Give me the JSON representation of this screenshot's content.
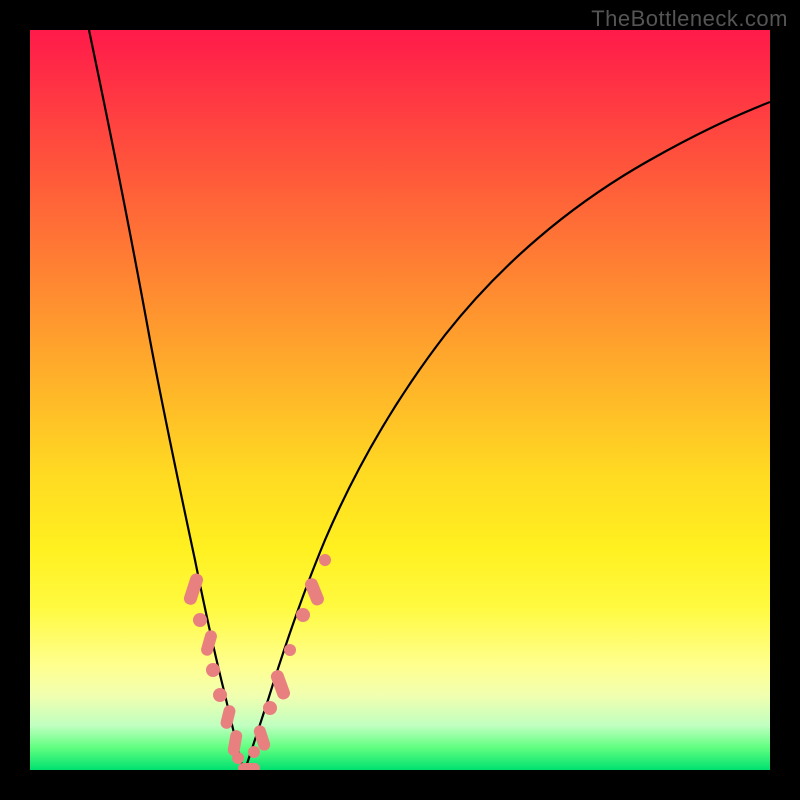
{
  "watermark": "TheBottleneck.com",
  "chart_data": {
    "type": "line",
    "title": "",
    "xlabel": "",
    "ylabel": "",
    "xlim": [
      0,
      100
    ],
    "ylim": [
      0,
      100
    ],
    "grid": false,
    "legend": false,
    "annotations": [],
    "background": "red-yellow-green vertical gradient",
    "series": [
      {
        "name": "left-curve",
        "x": [
          8,
          10,
          12,
          14,
          16,
          18,
          20,
          22,
          24,
          25,
          26,
          27,
          28
        ],
        "y": [
          100,
          85,
          70,
          57,
          45,
          35,
          26,
          18,
          10,
          6,
          3,
          1,
          0
        ]
      },
      {
        "name": "right-curve",
        "x": [
          28,
          30,
          32,
          35,
          38,
          42,
          48,
          55,
          65,
          78,
          92,
          100
        ],
        "y": [
          0,
          4,
          10,
          19,
          28,
          38,
          50,
          60,
          70,
          79,
          85,
          88
        ]
      }
    ],
    "markers": [
      {
        "series": "left",
        "x": 21.5,
        "y": 22,
        "shape": "pill"
      },
      {
        "series": "left",
        "x": 22.5,
        "y": 18,
        "shape": "dot"
      },
      {
        "series": "left",
        "x": 23.2,
        "y": 15,
        "shape": "pill"
      },
      {
        "series": "left",
        "x": 24,
        "y": 11,
        "shape": "dot"
      },
      {
        "series": "left",
        "x": 25,
        "y": 7,
        "shape": "dot"
      },
      {
        "series": "left",
        "x": 25.7,
        "y": 4.5,
        "shape": "pill"
      },
      {
        "series": "left",
        "x": 26.5,
        "y": 2,
        "shape": "pill"
      },
      {
        "series": "left",
        "x": 27.3,
        "y": 0.8,
        "shape": "dot"
      },
      {
        "series": "right",
        "x": 28.5,
        "y": 1,
        "shape": "pill"
      },
      {
        "series": "right",
        "x": 29.5,
        "y": 3,
        "shape": "dot"
      },
      {
        "series": "right",
        "x": 30.5,
        "y": 5.5,
        "shape": "pill"
      },
      {
        "series": "right",
        "x": 31.5,
        "y": 9,
        "shape": "dot"
      },
      {
        "series": "right",
        "x": 33,
        "y": 14,
        "shape": "pill"
      },
      {
        "series": "right",
        "x": 34,
        "y": 17,
        "shape": "dot"
      },
      {
        "series": "right",
        "x": 36,
        "y": 23,
        "shape": "dot"
      },
      {
        "series": "right",
        "x": 37,
        "y": 26,
        "shape": "pill"
      }
    ]
  }
}
